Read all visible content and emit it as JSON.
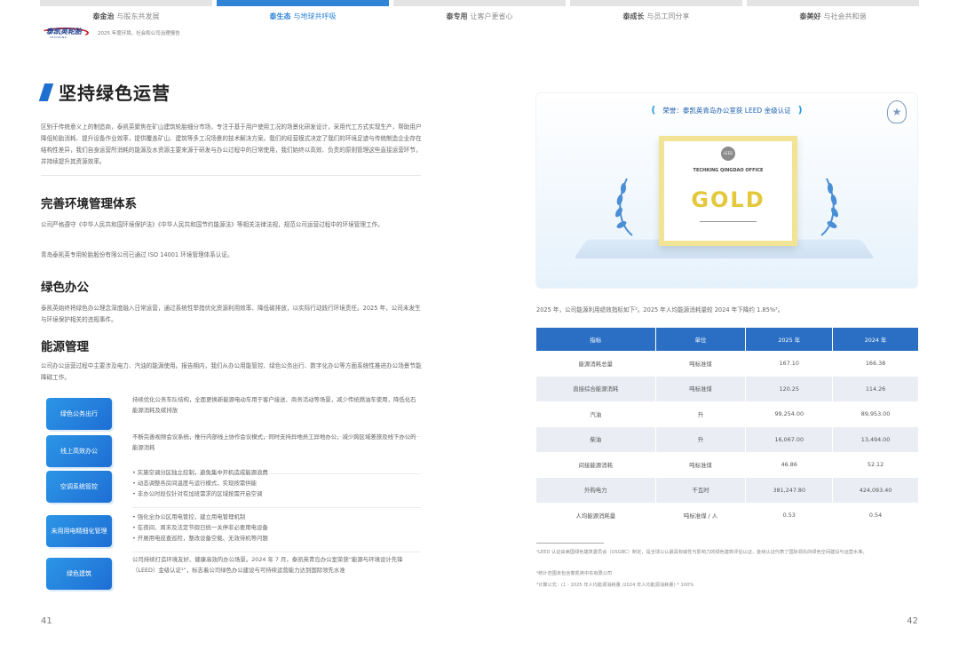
{
  "nav": {
    "tabs": [
      {
        "key": "泰金治",
        "text": "与股东共发展"
      },
      {
        "key": "泰生态",
        "text": "与地球共呼吸"
      },
      {
        "key": "泰专用",
        "text": "让客户更省心"
      },
      {
        "key": "泰成长",
        "text": "与员工同分享"
      },
      {
        "key": "泰美好",
        "text": "与社会共和谐"
      }
    ]
  },
  "brand": {
    "logo_text": "泰凯英轮胎",
    "logo_sub": "TECHKING",
    "report_title": "2025 年度环境、社会和公司治理报告"
  },
  "left": {
    "title": "坚持绿色运营",
    "intro": "区别于传统意义上的制造商，泰凯英聚焦在矿山建筑轮胎细分市场，专注于基于用户使用工况的场景化研发设计，采用代工方式实现生产，帮助用户降低轮胎消耗、提升设备作业效率，提供覆盖矿山、建筑等多工况场景的技术解决方案。我们的经营模式决定了我们的环境足迹与传统制造企业存在结构性差异，我们自身运营所消耗的能源及水资源主要来源于研发与办公过程中的日常使用，我们始终以高效、负责的原则管理这些直接运营环节，并持续提升其资源效率。",
    "s1_title": "完善环境管理体系",
    "s1_text": "公司严格遵守《中华人民共和国环境保护法》《中华人民共和国节约能源法》等相关法律法规，规范公司运营过程中的环境管理工作。",
    "s1_text2": "青岛泰凯英专用轮胎股份有限公司已通过 ISO 14001 环境管理体系认证。",
    "s2_title": "绿色办公",
    "s2_text": "泰凯英始终将绿色办公理念深度融入日常运营，通过系统性举措优化资源利用效率、降低碳排放，以实际行动践行环境责任。2025 年，公司未发生与环境保护相关的违规事件。",
    "s3_title": "能源管理",
    "s3_text": "公司办公运营过程中主要涉及电力、汽油的能源使用。报告期内，我们从办公用能管控、绿色公务出行、数字化办公等方面系统性推进办公场景节能降碳工作。",
    "measures": [
      {
        "label": "绿色公务出行",
        "desc": "持续优化公务车队结构，全面更换新能源电动车用于客户接送、商务活动等场景，减少传统燃油车使用，降低化石能源消耗及碳排放"
      },
      {
        "label": "线上高效办公",
        "desc": "不断完善视频会议系统，推行内部线上协作会议模式，同时支持异地员工异地办公，减少跨区域差旅及线下办公的能源消耗"
      },
      {
        "label": "空调系统管控",
        "desc": "• 实施空调分区独立控制，避免集中开机造成能源浪费\n• 动态调整各房间温度与运行模式，实现按需供能\n• 非办公时段仅针对有加班需求的区域按需开启空调"
      },
      {
        "label": "未用用电精细化管理",
        "desc": "• 强化全办公区用电管控，建立用电管理机制\n• 在夜间、周末及法定节假日统一关停非必要用电设备\n• 开展用电巡查巡检，整改设备空载、无效待机等问题"
      },
      {
        "label": "绿色建筑",
        "desc": "公司持续打造环境友好、健康高效的办公场景。2024 年 7 月，泰凯英青岛办公室荣获“能源与环境设计先锋（LEED）金级认证¹”，标志着公司绿色办公建设与可持续运营能力达到国际领先水准"
      }
    ],
    "page_number": "41"
  },
  "right": {
    "cert_caption": "荣誉：泰凯英青岛办公室获 LEED 金级认证",
    "cert": {
      "leed": "LEED",
      "office": "TECHKING QINGDAO OFFICE",
      "level": "GOLD"
    },
    "table_intro": "2025 年，公司能源利用绩效指标如下²。2025 年人均能源消耗量较 2024 年下降约 1.85%³。",
    "table": {
      "headers": [
        "指标",
        "单位",
        "2025 年",
        "2024 年"
      ],
      "rows": [
        [
          "能源消耗总量",
          "吨标准煤",
          "167.10",
          "166.38"
        ],
        [
          "直接综合能源消耗",
          "吨标准煤",
          "120.25",
          "114.26"
        ],
        [
          "汽油",
          "升",
          "99,254.00",
          "89,953.00"
        ],
        [
          "柴油",
          "升",
          "16,067.00",
          "13,494.00"
        ],
        [
          "间接能源消耗",
          "吨标准煤",
          "46.86",
          "52.12"
        ],
        [
          "外购电力",
          "千瓦时",
          "381,247.80",
          "424,093.40"
        ],
        [
          "人均能源消耗量",
          "吨标准煤 / 人",
          "0.53",
          "0.54"
        ]
      ]
    },
    "footnotes": [
      "¹LEED 认证由美国绿色建筑委员会（USGBC）制定，是全球公认最具权威性与影响力的绿色建筑评估认证，金级认证代表了国际领先的绿色空间建设与运营水准。",
      "²统计范围未包含泰凯英中东有限公司",
      "³计算公式：(1 - 2025 年人均能源消耗量 /2024 年人均能源消耗量) * 100%"
    ],
    "page_number": "42"
  },
  "colors": {
    "accent": "#2f84d8",
    "table_header": "#2a6fc4",
    "pill": "#1e6ed4"
  }
}
